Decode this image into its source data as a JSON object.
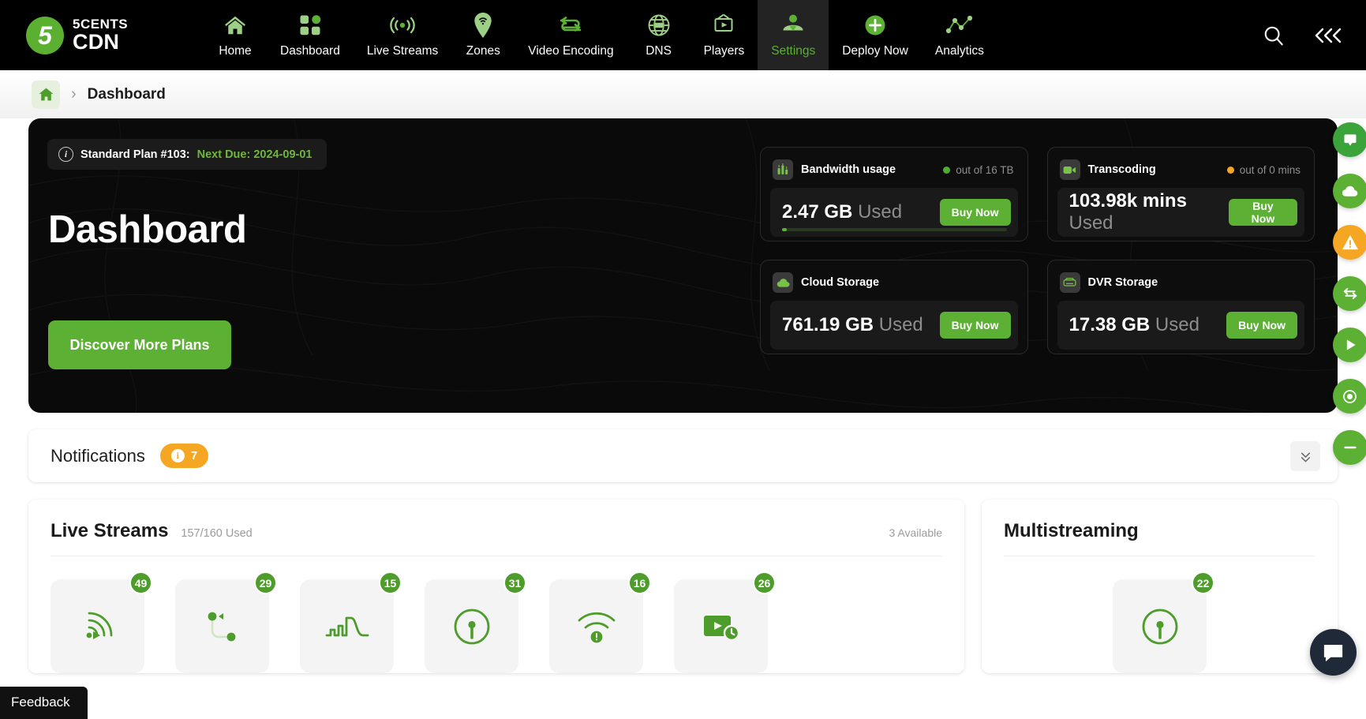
{
  "brand": {
    "mark": "5",
    "line1": "5CENTS",
    "line2": "CDN"
  },
  "nav": {
    "items": [
      {
        "label": "Home",
        "icon": "home-icon",
        "active": false
      },
      {
        "label": "Dashboard",
        "icon": "grid-icon",
        "active": false
      },
      {
        "label": "Live Streams",
        "icon": "broadcast-icon",
        "active": false
      },
      {
        "label": "Zones",
        "icon": "map-pin-wifi-icon",
        "active": false
      },
      {
        "label": "Video Encoding",
        "icon": "swap-arrows-icon",
        "active": false
      },
      {
        "label": "DNS",
        "icon": "globe-dns-icon",
        "active": false
      },
      {
        "label": "Players",
        "icon": "tv-play-icon",
        "active": false
      },
      {
        "label": "Settings",
        "icon": "user-settings-icon",
        "active": true
      },
      {
        "label": "Deploy Now",
        "icon": "plus-circle-icon",
        "active": false
      },
      {
        "label": "Analytics",
        "icon": "line-chart-icon",
        "active": false
      }
    ],
    "search_icon": "search-icon",
    "collapse_icon": "double-chevron-left-icon"
  },
  "breadcrumb": {
    "home_icon": "home-icon",
    "separator": "›",
    "current": "Dashboard"
  },
  "hero": {
    "plan_info_icon": "info-icon",
    "plan_label": "Standard Plan #103:",
    "plan_due": "Next Due: 2024-09-01",
    "title": "Dashboard",
    "cta": "Discover More Plans"
  },
  "usage_cards": [
    {
      "icon": "bar-chart-icon",
      "title": "Bandwidth usage",
      "quota": "out of 16 TB",
      "dot_color": "#4caf2f",
      "value": "2.47 GB",
      "unit_label": "Used",
      "buy_label": "Buy Now",
      "progress_percent": 2,
      "has_progress": true
    },
    {
      "icon": "video-camera-icon",
      "title": "Transcoding",
      "quota": "out of 0 mins",
      "dot_color": "#f5a623",
      "value": "103.98k mins",
      "unit_label": "Used",
      "buy_label": "Buy Now",
      "progress_percent": 0,
      "has_progress": false
    },
    {
      "icon": "cloud-icon",
      "title": "Cloud Storage",
      "quota": "",
      "dot_color": "",
      "value": "761.19 GB",
      "unit_label": "Used",
      "buy_label": "Buy Now",
      "progress_percent": 0,
      "has_progress": false
    },
    {
      "icon": "hard-drive-icon",
      "title": "DVR Storage",
      "quota": "",
      "dot_color": "",
      "value": "17.38 GB",
      "unit_label": "Used",
      "buy_label": "Buy Now",
      "progress_percent": 0,
      "has_progress": false
    }
  ],
  "notifications": {
    "title": "Notifications",
    "info_icon": "info-icon",
    "count": "7",
    "collapse_icon": "chevron-collapse-icon"
  },
  "live_streams": {
    "title": "Live Streams",
    "subtitle": "157/160 Used",
    "available": "3 Available",
    "tiles": [
      {
        "badge": "49",
        "icon": "stream-signal-icon"
      },
      {
        "badge": "29",
        "icon": "stream-pull-icon"
      },
      {
        "badge": "15",
        "icon": "waveform-icon"
      },
      {
        "badge": "31",
        "icon": "broadcast-tower-icon"
      },
      {
        "badge": "16",
        "icon": "wifi-alert-icon"
      },
      {
        "badge": "26",
        "icon": "scheduled-play-icon"
      }
    ]
  },
  "multistreaming": {
    "title": "Multistreaming",
    "tiles": [
      {
        "badge": "22",
        "icon": "broadcast-tower-icon"
      }
    ]
  },
  "rail": [
    {
      "icon": "rail-tooltip-icon",
      "color": "#3aa33a"
    },
    {
      "icon": "rail-cloud-icon",
      "color": "#5cb033"
    },
    {
      "icon": "rail-warning-icon",
      "color": "#f5a623"
    },
    {
      "icon": "rail-swap-icon",
      "color": "#5cb033"
    },
    {
      "icon": "rail-play-icon",
      "color": "#5cb033"
    },
    {
      "icon": "rail-target-icon",
      "color": "#5cb033"
    },
    {
      "icon": "rail-minus-icon",
      "color": "#5cb033"
    }
  ],
  "chat": {
    "icon": "chat-bubble-icon"
  },
  "feedback": {
    "label": "Feedback"
  },
  "colors": {
    "brand_green": "#5cb033",
    "accent_orange": "#f5a623",
    "nav_bg": "#000000"
  }
}
